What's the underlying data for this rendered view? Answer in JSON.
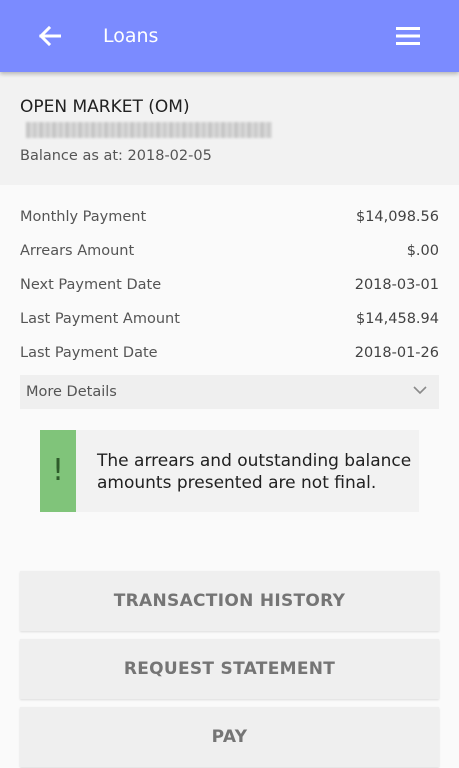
{
  "appbar": {
    "title": "Loans",
    "back_icon": "arrow-left-icon",
    "menu_icon": "hamburger-menu-icon",
    "color": "#7b8bff"
  },
  "account": {
    "name": "OPEN MARKET (OM)",
    "balance_line": "Balance as at: 2018-02-05"
  },
  "details": [
    {
      "label": "Monthly Payment",
      "value": "$14,098.56"
    },
    {
      "label": "Arrears Amount",
      "value": "$.00"
    },
    {
      "label": "Next Payment Date",
      "value": "2018-03-01"
    },
    {
      "label": "Last Payment Amount",
      "value": "$14,458.94"
    },
    {
      "label": "Last Payment Date",
      "value": "2018-01-26"
    }
  ],
  "more_details": {
    "label": "More Details",
    "icon": "chevron-down-icon"
  },
  "notice": {
    "mark": "!",
    "text": "The arrears and outstanding balance amounts presented are not final.",
    "color": "#80c47a"
  },
  "actions": {
    "transaction_history": "TRANSACTION HISTORY",
    "request_statement": "REQUEST STATEMENT",
    "pay": "PAY"
  }
}
